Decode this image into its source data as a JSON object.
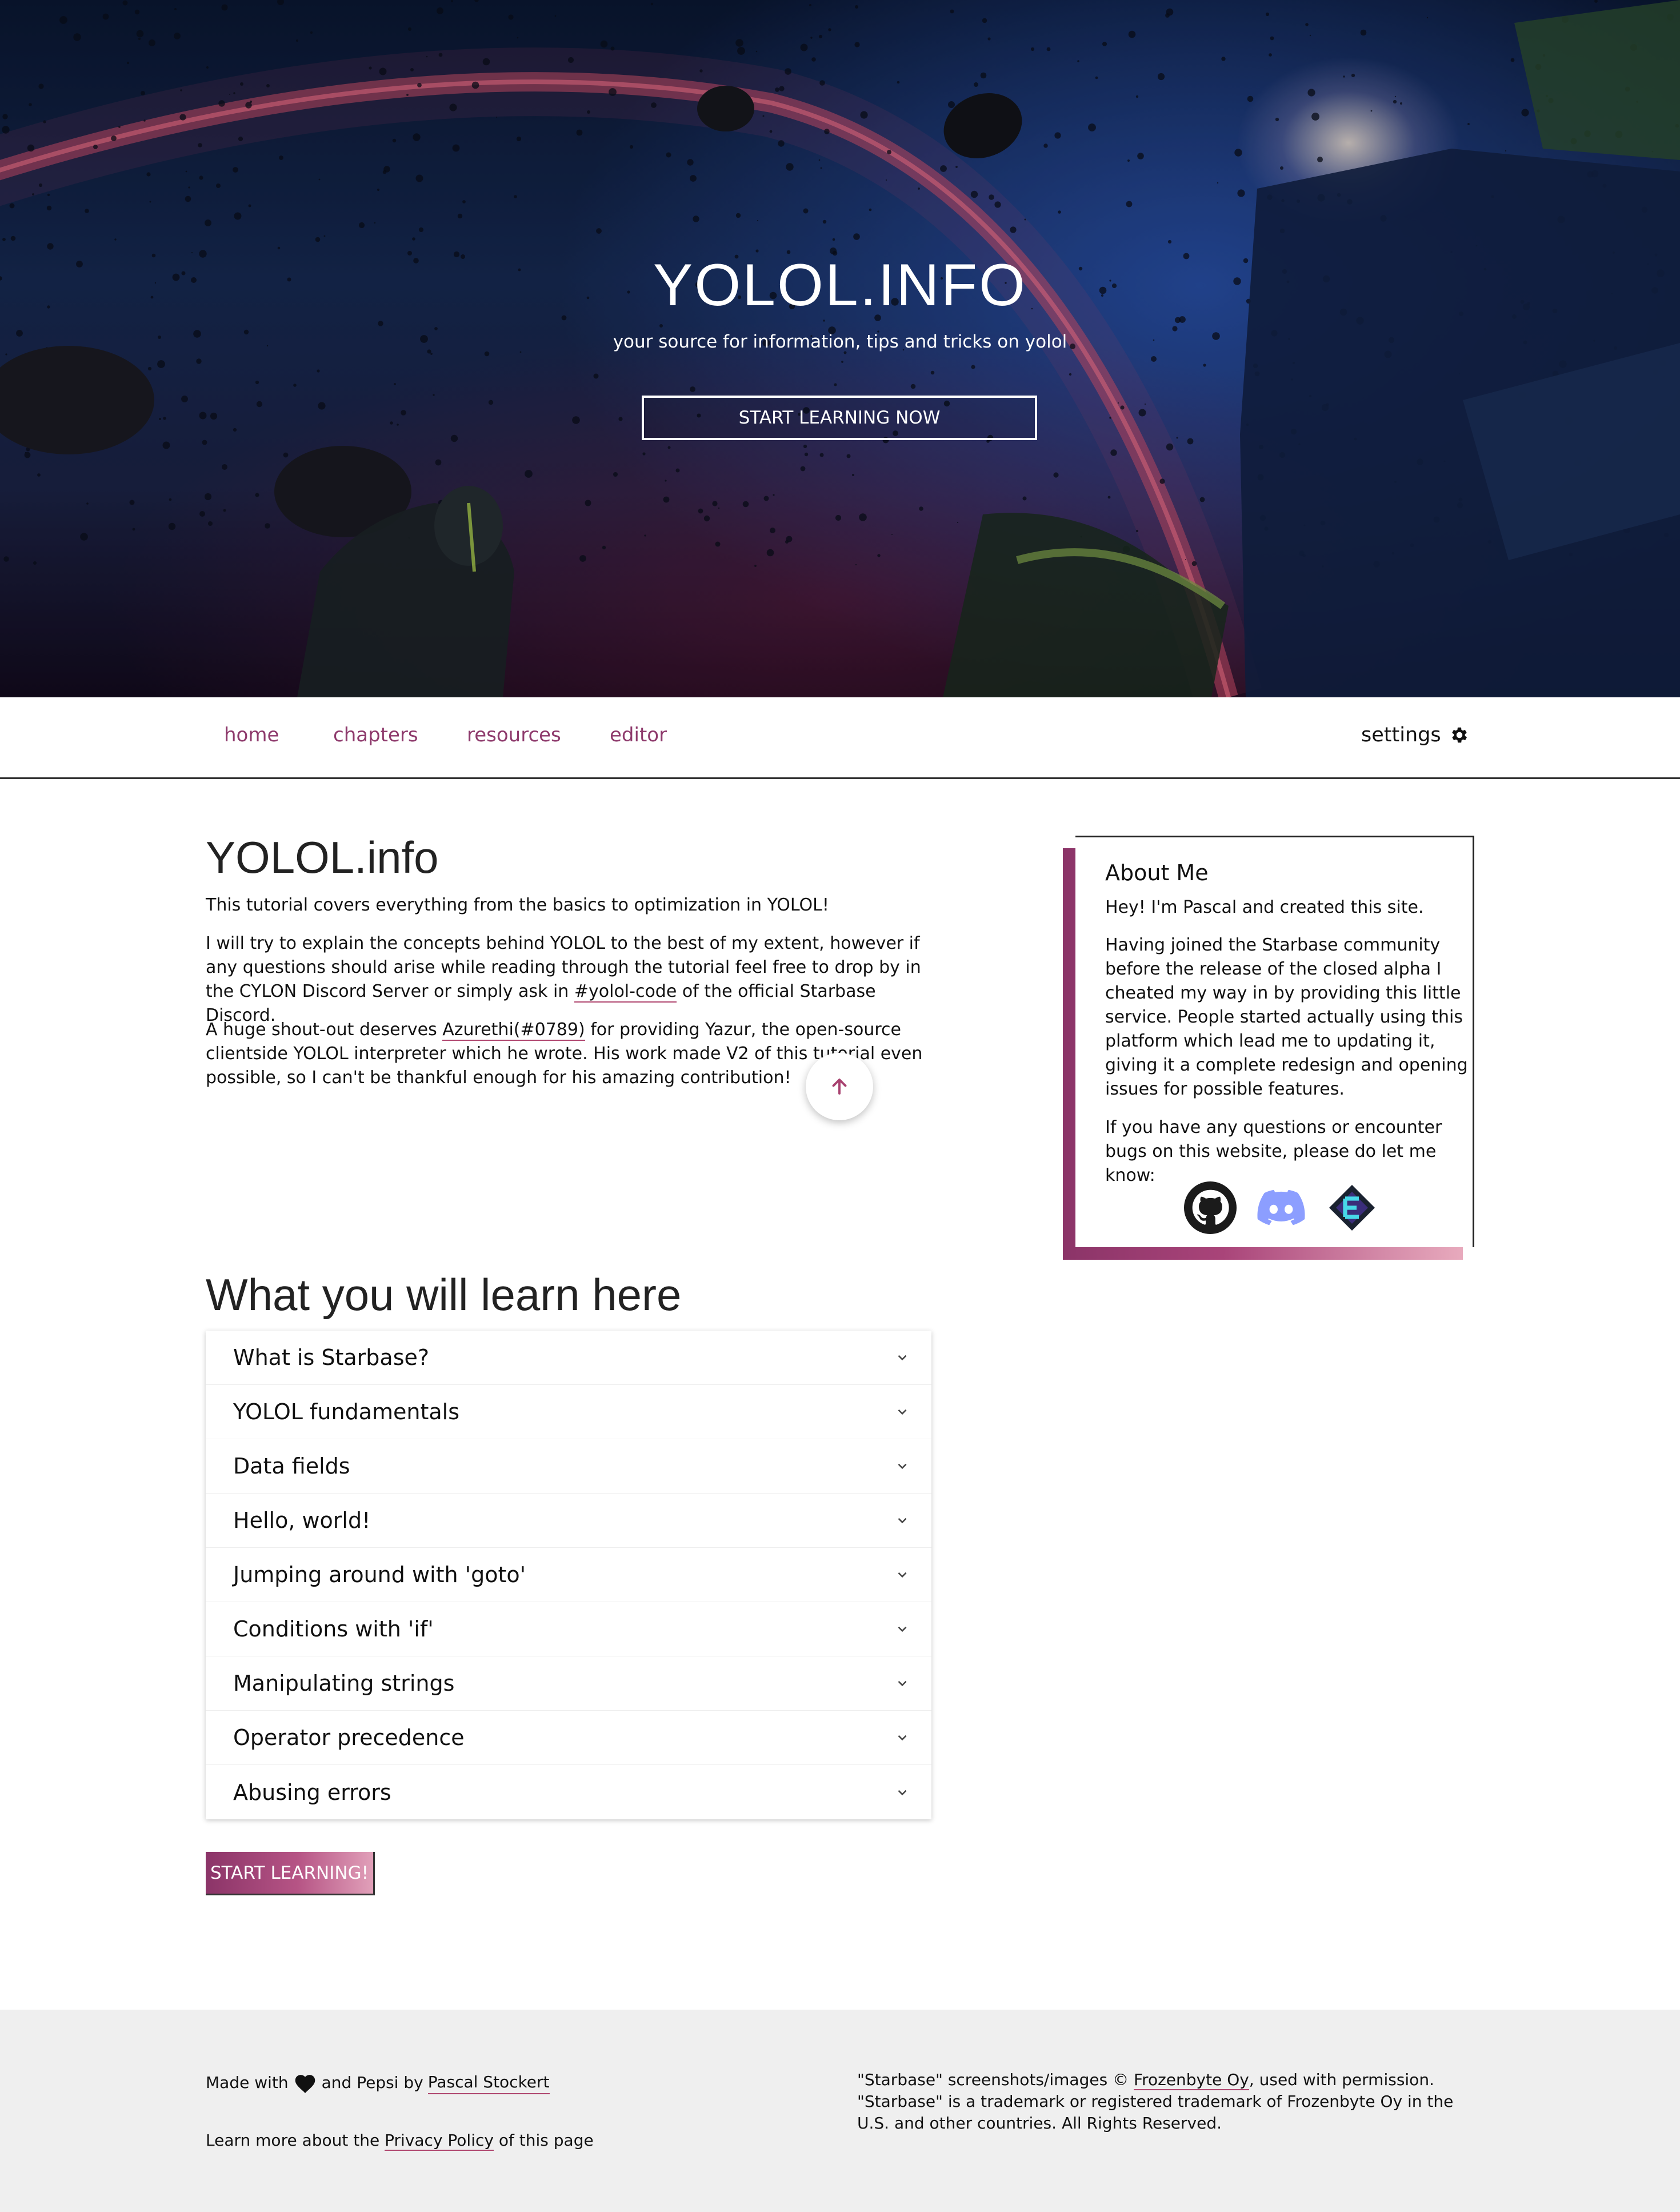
{
  "hero": {
    "title": "YOLOL.INFO",
    "subtitle": "your source for information, tips and tricks on yolol",
    "cta_label": "START LEARNING NOW"
  },
  "nav": {
    "items": [
      {
        "label": "home"
      },
      {
        "label": "chapters"
      },
      {
        "label": "resources"
      },
      {
        "label": "editor"
      }
    ],
    "settings_label": "settings",
    "settings_icon": "gear-icon"
  },
  "main": {
    "title": "YOLOL.info",
    "intro": "This tutorial covers everything from the basics to optimization in YOLOL!",
    "p2_before": "I will try to explain the concepts behind YOLOL to the best of my extent, however if any questions should arise while reading through the tutorial feel free to drop by in the CYLON Discord Server or simply ask in ",
    "p2_link": "#yolol-code",
    "p2_after": " of the official Starbase Discord.",
    "p3_before": "A huge shout-out deserves ",
    "p3_link": "Azurethi(#0789)",
    "p3_after": " for providing Yazur, the open-source clientside YOLOL interpreter which he wrote. His work made V2 of this tutorial even possible, so I can't be thankful enough for his amazing contribution!"
  },
  "about": {
    "heading": "About Me",
    "p1": "Hey! I'm Pascal and created this site.",
    "p2": "Having joined the Starbase community before the release of the closed alpha I cheated my way in by providing this little service. People started actually using this platform which lead me to updating it, giving it a complete redesign and opening issues for possible features.",
    "p3": "If you have any questions or encounter bugs on this website, please do let me know:",
    "icons": [
      "github-icon",
      "discord-icon",
      "starbase-icon"
    ]
  },
  "learn": {
    "title": "What you will learn here",
    "chapters": [
      {
        "label": "What is Starbase?"
      },
      {
        "label": "YOLOL fundamentals"
      },
      {
        "label": "Data fields"
      },
      {
        "label": "Hello, world!"
      },
      {
        "label": "Jumping around with 'goto'"
      },
      {
        "label": "Conditions with 'if'"
      },
      {
        "label": "Manipulating strings"
      },
      {
        "label": "Operator precedence"
      },
      {
        "label": "Abusing errors"
      }
    ],
    "start_label": "START LEARNING!"
  },
  "footer": {
    "made_with": "Made with",
    "and_pepsi": "and Pepsi by",
    "author": "Pascal Stockert",
    "learn_more": "Learn more about the",
    "privacy": "Privacy Policy",
    "of_page": "of this page",
    "copy_before": "\"Starbase\" screenshots/images © ",
    "copy_link": "Frozenbyte Oy",
    "copy_after": ", used with permission. \"Starbase\" is a trademark or registered trademark of Frozenbyte Oy in the U.S. and other countries. All Rights Reserved."
  },
  "colors": {
    "accent": "#8e3a6c",
    "accent_light": "#e1a0b9",
    "footer_bg": "#efefef"
  }
}
